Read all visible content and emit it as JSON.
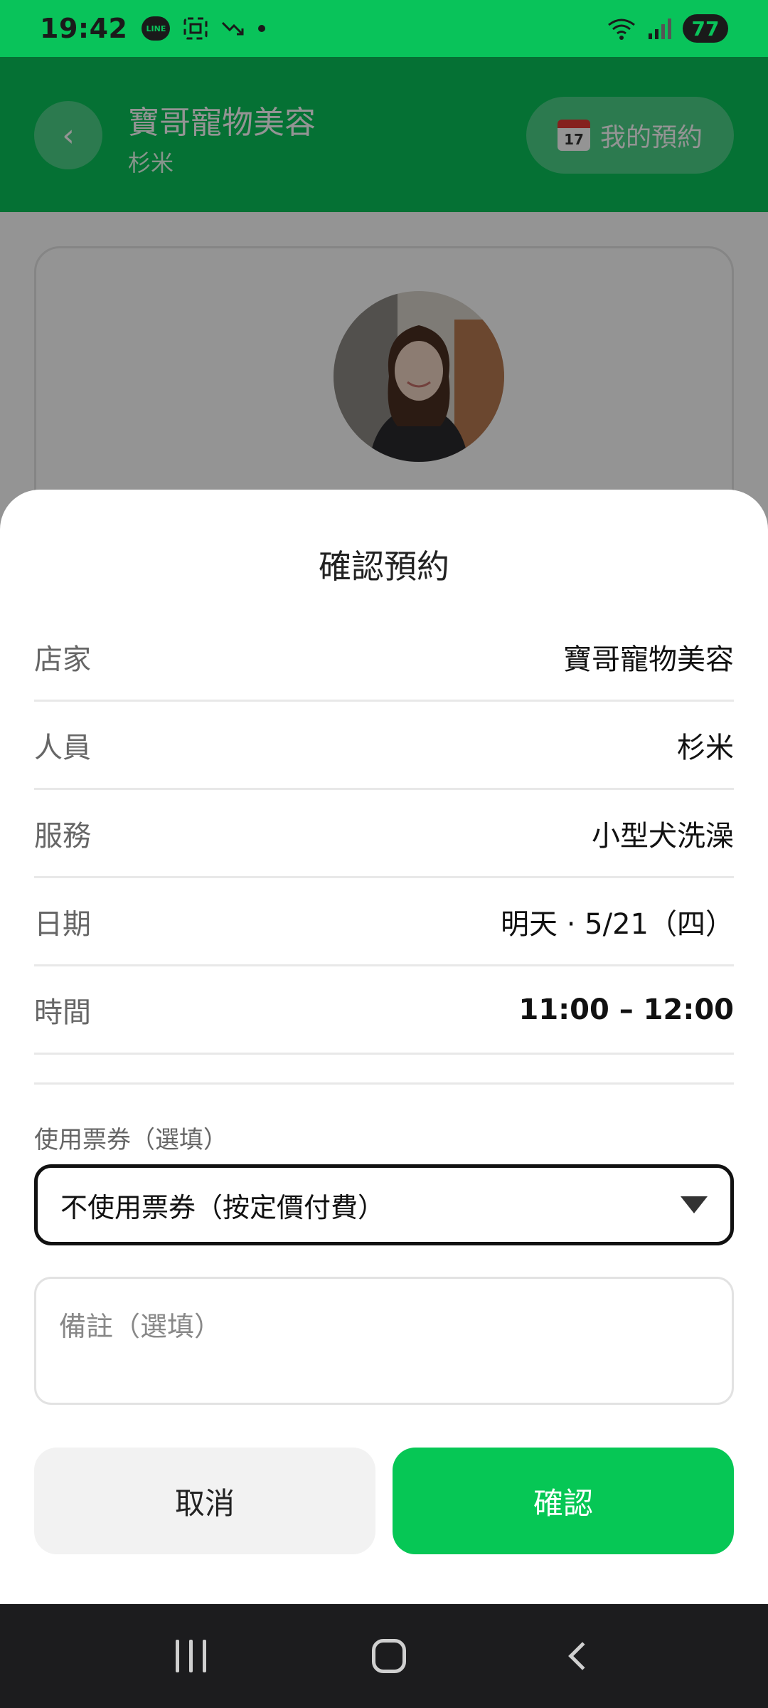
{
  "status_bar": {
    "time": "19:42",
    "battery": "77",
    "line_badge": "LINE"
  },
  "header": {
    "back_icon": "‹",
    "title": "寶哥寵物美容",
    "subtitle": "杉米",
    "my_bookings_label": "我的預約",
    "calendar_day": "17"
  },
  "sheet": {
    "title": "確認預約",
    "rows": [
      {
        "label": "店家",
        "value": "寶哥寵物美容"
      },
      {
        "label": "人員",
        "value": "杉米"
      },
      {
        "label": "服務",
        "value": "小型犬洗澡"
      },
      {
        "label": "日期",
        "value": "明天 · 5/21（四）"
      },
      {
        "label": "時間",
        "value": "11:00 – 12:00"
      }
    ],
    "coupon_label": "使用票券（選填）",
    "coupon_selected": "不使用票券（按定價付費）",
    "note_placeholder": "備註（選填）",
    "cancel_label": "取消",
    "confirm_label": "確認"
  },
  "colors": {
    "brand_green": "#09c35a",
    "confirm_green": "#06c755",
    "nav_bg": "#1c1c1e"
  },
  "icons": [
    "line-app-icon",
    "screenshot-icon",
    "trend-icon",
    "wifi-icon",
    "signal-icon",
    "back-chevron-icon",
    "calendar-icon",
    "dropdown-triangle-icon",
    "recent-apps-icon",
    "home-icon",
    "nav-back-icon"
  ]
}
